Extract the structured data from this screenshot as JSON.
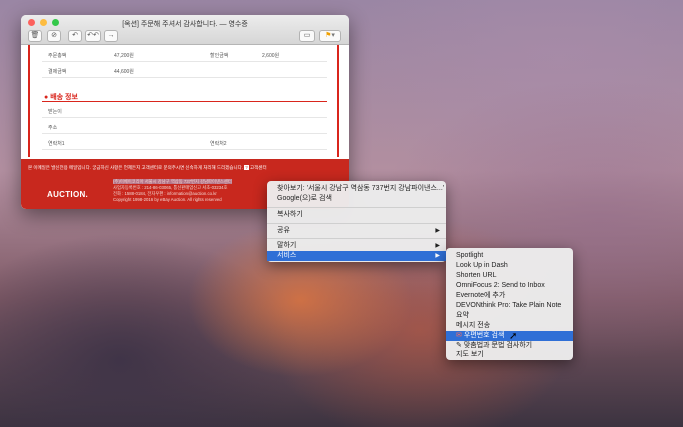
{
  "window": {
    "title": "[옥션] 주문해 주셔서 감사합니다. — 영수증",
    "accent": "#c8281e"
  },
  "order": [
    {
      "label": "주문총액",
      "value": "47,200원",
      "label2": "할인금액",
      "value2": "2,600원"
    },
    {
      "label": "결제금액",
      "value": "44,600원"
    }
  ],
  "shipping": {
    "heading": "배송 정보",
    "fields": [
      "받는이",
      "주소",
      "연락처1"
    ],
    "field2": "연락처2"
  },
  "footer": {
    "notice": "본 이메일은 발신전용 메일입니다. 궁금하신 사항은 언제든지 고객센터로 문의주시면 신속하게 처리해 드리겠습니다.",
    "center": "고객센터",
    "logo": "AUCTION.",
    "line1": "(주)이베이코리아 서울시 강남구 역삼동 737번지 강남파이낸스센터",
    "line2": "사업자등록번호 : 214-86-03065, 통신판매업신고 서초-03234호",
    "line3": "전화 : 1588-0184, 전자우편 : information@auction.co.kr",
    "line4": "Copyright 1998-2016 by eBay Auction. All rights reserved"
  },
  "context_menu": {
    "items": [
      "찾아보기: '서울시 강남구 역삼동 737번지 강남파이낸스...'",
      "Google(으)로 검색",
      "복사하기",
      "공유",
      "말하기",
      "서비스"
    ]
  },
  "services_submenu": {
    "items": [
      "Spotlight",
      "Look Up in Dash",
      "Shorten URL",
      "OmniFocus 2: Send to Inbox",
      "Evernote에 추가",
      "DEVONthink Pro: Take Plain Note",
      "요약",
      "메시지 전송",
      "우편번호 검색",
      "맞춤법과 문법 검사하기",
      "지도 보기"
    ]
  }
}
